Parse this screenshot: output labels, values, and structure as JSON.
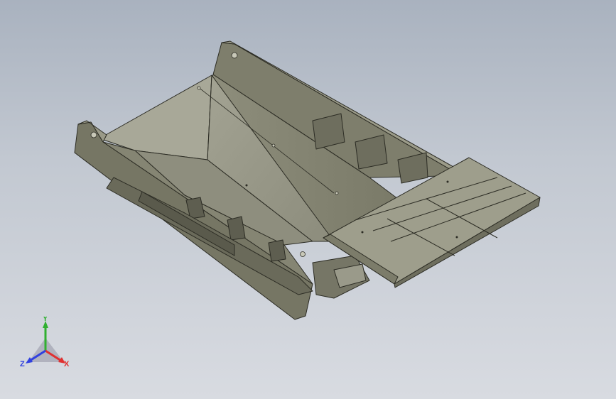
{
  "viewport": {
    "background_top": "#a9b2bf",
    "background_bottom": "#d8dbe1",
    "model_color": "#8a8a78",
    "model_edge_color": "#2c2c24"
  },
  "triad": {
    "x_label": "X",
    "y_label": "Y",
    "z_label": "Z",
    "x_color": "#e03030",
    "y_color": "#30b030",
    "z_color": "#3040e0"
  }
}
